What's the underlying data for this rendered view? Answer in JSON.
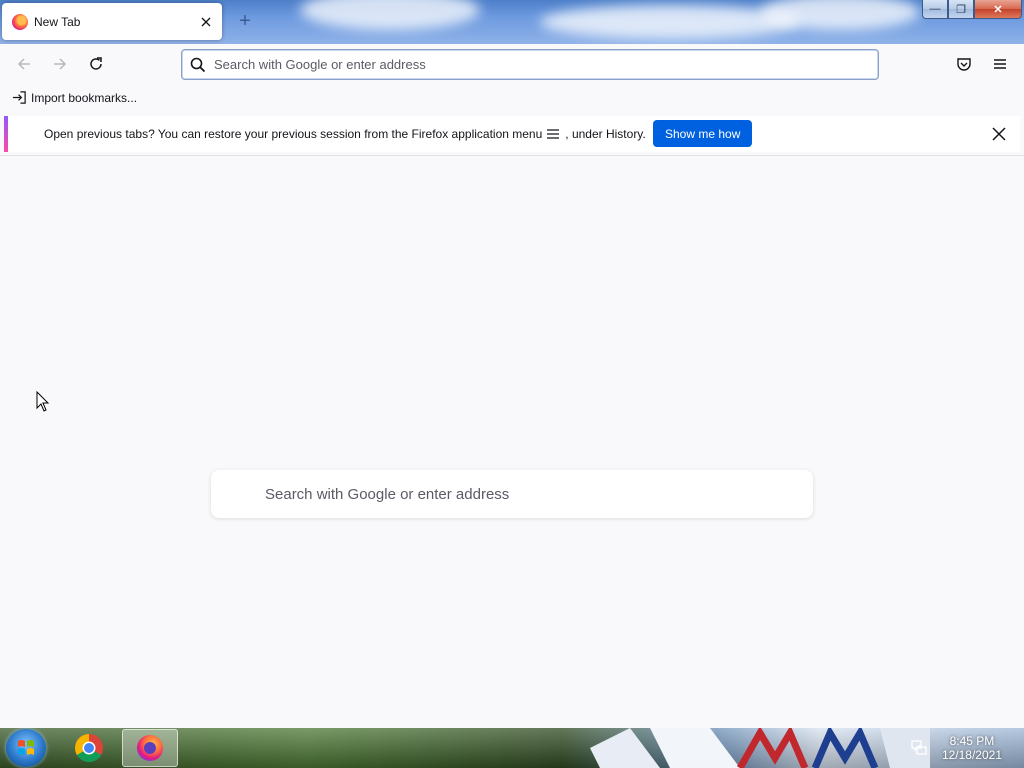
{
  "window": {
    "tab_title": "New Tab",
    "new_tab_symbol": "+",
    "minimize_symbol": "—",
    "maximize_symbol": "❐",
    "close_symbol": "✕"
  },
  "navbar": {
    "back_icon": "back-arrow-icon",
    "forward_icon": "forward-arrow-icon",
    "reload_icon": "reload-icon",
    "url_placeholder": "Search with Google or enter address",
    "pocket_icon": "pocket-icon",
    "menu_icon": "hamburger-menu-icon"
  },
  "bookmarks": {
    "import_label": "Import bookmarks..."
  },
  "notification": {
    "message_before": "Open previous tabs? You can restore your previous session from the Firefox application menu",
    "message_after": ", under History.",
    "button_label": "Show me how",
    "accent_colors": [
      "#9059ff",
      "#ff4aa2"
    ],
    "button_color": "#0061e0"
  },
  "content": {
    "search_placeholder": "Search with Google or enter address"
  },
  "taskbar": {
    "apps": [
      "chrome-icon",
      "firefox-icon"
    ],
    "active_app": "firefox-icon",
    "time": "8:45 PM",
    "date": "12/18/2021"
  }
}
